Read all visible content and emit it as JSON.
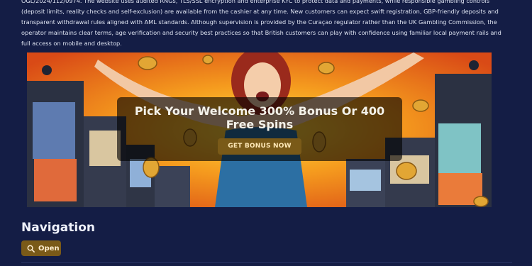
{
  "intro": {
    "text": "OGL/2024/112/0974. The website uses audited RNGs, TLS/SSL encryption and enterprise KYC to protect data and payments, while responsible gambling controls (deposit limits, reality checks and self-exclusion) are available from the cashier at any time. New customers can expect swift registration, GBP-friendly deposits and transparent withdrawal rules aligned with AML standards. Although supervision is provided by the Curaçao regulator rather than the UK Gambling Commission, the operator maintains clear terms, age verification and security best practices so that British customers can play with confidence using familiar local payment rails and full access on mobile and desktop."
  },
  "banner": {
    "title": "Pick Your Welcome 300% Bonus Or 400 Free Spins",
    "cta_label": "GET BONUS NOW"
  },
  "navigation": {
    "heading": "Navigation",
    "open_label": "Open",
    "open_icon": "search-icon"
  },
  "colors": {
    "page_bg": "#141d45",
    "button_bg": "#7a5a18",
    "accent_gold": "#e2a634"
  }
}
